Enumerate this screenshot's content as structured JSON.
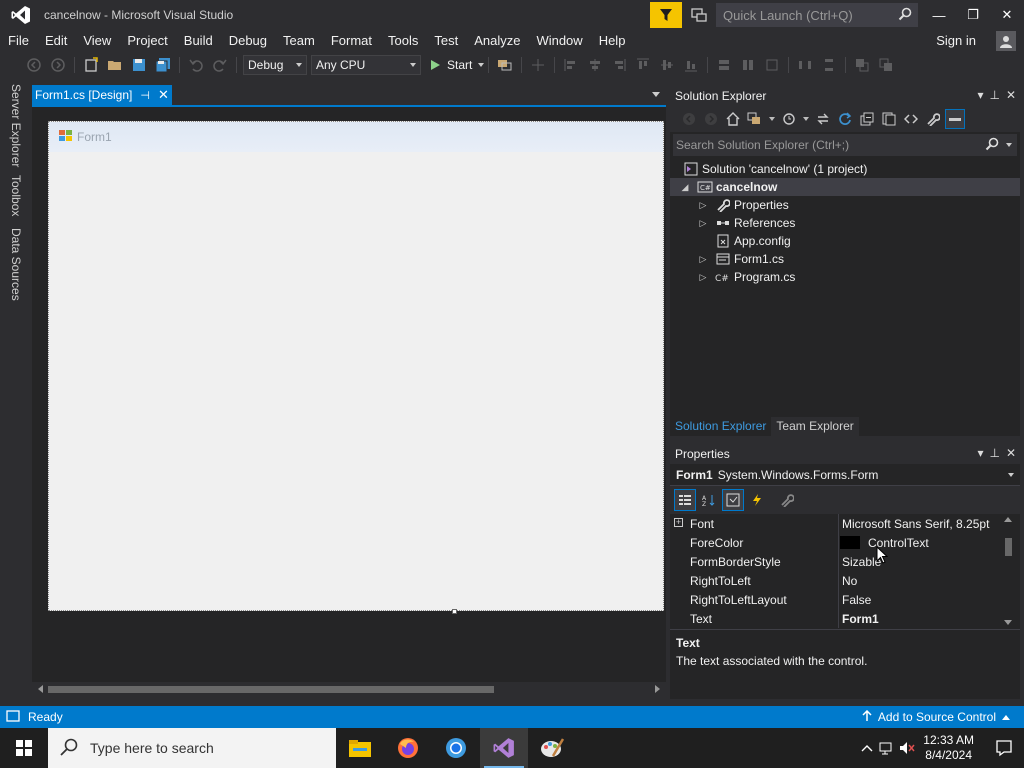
{
  "window": {
    "title": "cancelnow - Microsoft Visual Studio",
    "quick_launch_placeholder": "Quick Launch (Ctrl+Q)",
    "minimize": "—",
    "restore": "❐",
    "close": "✕"
  },
  "menu": {
    "items": [
      "File",
      "Edit",
      "View",
      "Project",
      "Build",
      "Debug",
      "Team",
      "Format",
      "Tools",
      "Test",
      "Analyze",
      "Window",
      "Help"
    ],
    "sign_in": "Sign in"
  },
  "toolbar": {
    "config": "Debug",
    "platform": "Any CPU",
    "start": "Start"
  },
  "left_tabs": [
    "Server Explorer",
    "Toolbox",
    "Data Sources"
  ],
  "document": {
    "tab_label": "Form1.cs [Design]",
    "form_title": "Form1"
  },
  "solution_explorer": {
    "title": "Solution Explorer",
    "search_placeholder": "Search Solution Explorer (Ctrl+;)",
    "solution": "Solution 'cancelnow' (1 project)",
    "project": "cancelnow",
    "items": [
      "Properties",
      "References",
      "App.config",
      "Form1.cs",
      "Program.cs"
    ],
    "tab_active": "Solution Explorer",
    "tab_inactive": "Team Explorer"
  },
  "properties": {
    "title": "Properties",
    "object_name": "Form1",
    "object_type": "System.Windows.Forms.Form",
    "rows": [
      {
        "name": "Font",
        "value": "Microsoft Sans Serif, 8.25pt"
      },
      {
        "name": "ForeColor",
        "value": "ControlText"
      },
      {
        "name": "FormBorderStyle",
        "value": "Sizable"
      },
      {
        "name": "RightToLeft",
        "value": "No"
      },
      {
        "name": "RightToLeftLayout",
        "value": "False"
      },
      {
        "name": "Text",
        "value": "Form1"
      }
    ],
    "desc_title": "Text",
    "desc_text": "The text associated with the control."
  },
  "status": {
    "ready": "Ready",
    "source_control": "Add to Source Control"
  },
  "taskbar": {
    "search_placeholder": "Type here to search",
    "time": "12:33 AM",
    "date": "8/4/2024"
  },
  "colors": {
    "accent": "#007acc",
    "background": "#2d2d30",
    "panel": "#252526",
    "filter_yellow": "#f5c400"
  }
}
